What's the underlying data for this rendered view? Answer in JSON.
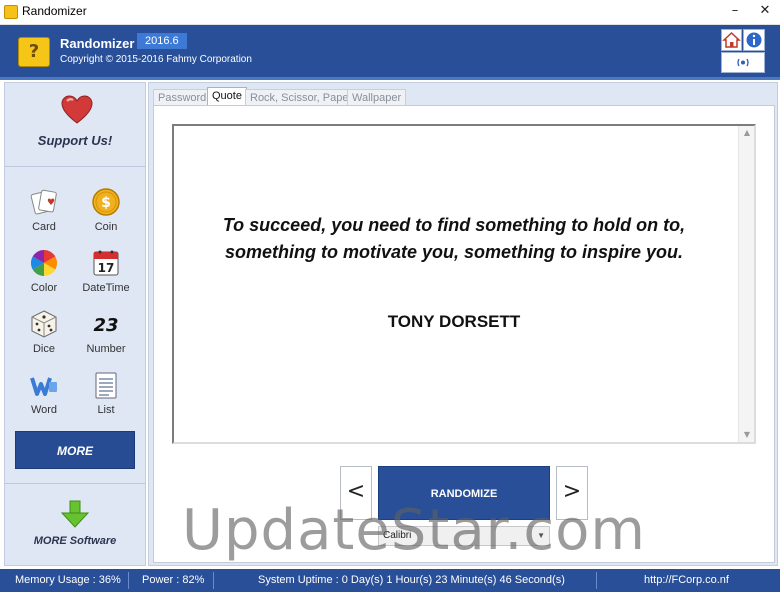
{
  "window": {
    "title": "Randomizer",
    "minimize": "–",
    "close": "✕"
  },
  "header": {
    "app_name": "Randomizer",
    "version": "2016.6",
    "copyright": "Copyright © 2015-2016 Fahmy Corporation",
    "logo_glyph": "?"
  },
  "sidebar": {
    "support_label": "Support Us!",
    "tools": [
      {
        "label": "Card",
        "icon": "card-icon"
      },
      {
        "label": "Coin",
        "icon": "coin-icon"
      },
      {
        "label": "Color",
        "icon": "color-wheel-icon"
      },
      {
        "label": "DateTime",
        "icon": "calendar-icon",
        "glyph": "17"
      },
      {
        "label": "Dice",
        "icon": "dice-icon"
      },
      {
        "label": "Number",
        "icon": "number-icon",
        "glyph": "23"
      },
      {
        "label": "Word",
        "icon": "word-icon"
      },
      {
        "label": "List",
        "icon": "list-icon"
      }
    ],
    "more_label": "MORE",
    "more_software_label": "MORE Software"
  },
  "tabs": [
    {
      "label": "Password",
      "active": false
    },
    {
      "label": "Quote",
      "active": true
    },
    {
      "label": "Rock, Scissor, Paper",
      "active": false
    },
    {
      "label": "Wallpaper",
      "active": false
    }
  ],
  "quote": {
    "text": "To succeed, you need to find something to hold on to, something to motivate you, something to inspire you.",
    "author": "TONY DORSETT"
  },
  "controls": {
    "prev": "<",
    "next": ">",
    "randomize_label": "RANDOMIZE",
    "font_value": "Calibri"
  },
  "watermark": "UpdateStar.com",
  "status": {
    "memory": "Memory Usage : 36%",
    "power": "Power : 82%",
    "uptime": "System Uptime : 0 Day(s) 1 Hour(s) 23 Minute(s) 46 Second(s)",
    "url": "http://FCorp.co.nf"
  },
  "colors": {
    "brand_blue": "#284f98",
    "sidebar_bg": "#dfe7f4",
    "coin_gold": "#f0b020",
    "heart_red": "#d23a3a",
    "arrow_green": "#66c22e"
  }
}
